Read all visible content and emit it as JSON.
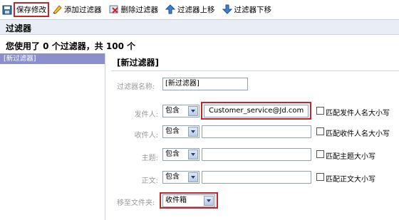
{
  "toolbar": {
    "save_label": "保存修改",
    "add_label": "添加过滤器",
    "delete_label": "删除过滤器",
    "up_label": "过滤器上移",
    "down_label": "过滤器下移",
    "icons": [
      "save-icon",
      "add-filter-icon",
      "delete-filter-icon",
      "arrow-up-icon",
      "arrow-down-icon"
    ]
  },
  "header": {
    "title": "过滤器",
    "summary": "您使用了 0 个过滤器，共 100 个"
  },
  "sidebar": {
    "items": [
      {
        "label": "[新过滤器]",
        "selected": true
      }
    ]
  },
  "form": {
    "title": "[新过滤器]",
    "name_label": "过滤器名称:",
    "name_value": "[新过滤器]",
    "rows": [
      {
        "label": "发件人:",
        "op": "包含",
        "value": "Customer_service@Jd.com",
        "match_label": "匹配发件人名大小写"
      },
      {
        "label": "收件人:",
        "op": "包含",
        "value": "",
        "match_label": "匹配收件人名大小写"
      },
      {
        "label": "主题:",
        "op": "包含",
        "value": "",
        "match_label": "匹配主题大小写"
      },
      {
        "label": "正文:",
        "op": "包含",
        "value": "",
        "match_label": "匹配正文大小写"
      }
    ],
    "move_label": "移至文件夹:",
    "move_value": "收件箱"
  },
  "colors": {
    "highlight_border": "#c0262c",
    "selected_item_bg": "#8c8fc9",
    "title_bar_bg": "#e9eef6"
  }
}
